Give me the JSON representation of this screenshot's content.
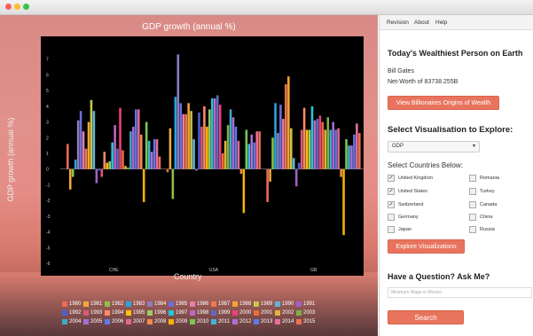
{
  "window": {
    "buttons": [
      "#fc5e57",
      "#fdbc2e",
      "#33c748"
    ]
  },
  "menu": {
    "items": [
      "Revision",
      "About",
      "Help"
    ]
  },
  "chart_data": {
    "type": "bar",
    "title": "GDP growth (annual %)",
    "xlabel": "Country",
    "ylabel": "GDP growth (annual %)",
    "ylim": [
      -6,
      8
    ],
    "yticks": [
      "7",
      "6",
      "5",
      "4",
      "3",
      "2",
      "1",
      "0",
      "-1",
      "-2",
      "-3",
      "-4",
      "-5",
      "-6"
    ],
    "categories": [
      "CHE",
      "USA",
      "GB"
    ],
    "series_colors": [
      "#ee6a56",
      "#f2a93b",
      "#8bc34a",
      "#29a6df",
      "#8e7cc3",
      "#6f6ed9",
      "#e67eac",
      "#f07a4a",
      "#f6a335",
      "#c6c84a",
      "#5fb7d6",
      "#9f61c8",
      "#4c5fd1",
      "#d85b7a",
      "#ff8a65",
      "#ffc107",
      "#9ccc65",
      "#26c6da",
      "#ba68c8",
      "#5c6bc0",
      "#ec407a",
      "#ef6c3a",
      "#e0b43c",
      "#7cb342",
      "#3fa9c9",
      "#a66dd4",
      "#6078ea",
      "#e06a8e",
      "#f28c4a",
      "#f4b400",
      "#78c850",
      "#40b4d8",
      "#b06fd6",
      "#5b7ae6",
      "#e76f9d",
      "#ed7053"
    ],
    "series": [
      {
        "name": "CHE",
        "values": [
          1.6,
          -1.3,
          -0.5,
          0.6,
          3.1,
          3.7,
          2.4,
          1.3,
          3.0,
          4.4,
          3.7,
          -0.9,
          -0.1,
          -0.5,
          1.1,
          0.4,
          0.5,
          1.7,
          2.8,
          1.3,
          3.9,
          1.2,
          0.2,
          0.1,
          2.4,
          2.7,
          3.8,
          3.8,
          2.2,
          -2.1,
          3.0,
          1.8,
          1.1,
          1.9,
          1.9,
          0.8
        ]
      },
      {
        "name": "USA",
        "values": [
          -0.2,
          2.6,
          -1.9,
          4.6,
          7.3,
          4.2,
          3.5,
          3.5,
          4.2,
          3.7,
          1.9,
          -0.1,
          3.6,
          2.7,
          4.0,
          2.7,
          3.8,
          4.5,
          4.5,
          4.7,
          4.1,
          1.0,
          1.8,
          2.8,
          3.8,
          3.3,
          2.7,
          1.8,
          -0.3,
          -2.8,
          2.5,
          1.6,
          2.2,
          1.7,
          2.4,
          2.4
        ]
      },
      {
        "name": "GB",
        "values": [
          -2.1,
          -0.8,
          2.0,
          4.2,
          2.3,
          4.1,
          3.2,
          5.4,
          5.9,
          2.6,
          0.7,
          -1.1,
          0.4,
          2.5,
          3.9,
          2.5,
          2.5,
          4.0,
          3.1,
          3.2,
          3.4,
          3.0,
          2.5,
          3.3,
          2.5,
          3.0,
          2.5,
          2.6,
          -0.5,
          -4.2,
          1.9,
          1.5,
          1.5,
          2.2,
          2.9,
          2.3
        ]
      }
    ],
    "legend": [
      "1980",
      "1981",
      "1982",
      "1983",
      "1984",
      "1985",
      "1986",
      "1987",
      "1988",
      "1989",
      "1990",
      "1991",
      "1992",
      "1993",
      "1994",
      "1995",
      "1996",
      "1997",
      "1998",
      "1999",
      "2000",
      "2001",
      "2002",
      "2003",
      "2004",
      "2005",
      "2006",
      "2007",
      "2008",
      "2009",
      "2010",
      "2011",
      "2012",
      "2013",
      "2014",
      "2015"
    ]
  },
  "panel": {
    "richest_title": "Today's Wealthiest Person on Earth",
    "person_name": "Bill Gates",
    "net_worth": "Net-Worth of 83738.255B",
    "origins_button": "View Billionaires Origins of Wealth",
    "explore_title": "Select Visualisation to Explore:",
    "select_value": "GDP",
    "countries_title": "Select Countries Below:",
    "countries": [
      {
        "label": "United Kingdom",
        "checked": true
      },
      {
        "label": "Romania",
        "checked": false
      },
      {
        "label": "United States",
        "checked": true
      },
      {
        "label": "Turkey",
        "checked": false
      },
      {
        "label": "Switzerland",
        "checked": true
      },
      {
        "label": "Canada",
        "checked": false
      },
      {
        "label": "Germany",
        "checked": false
      },
      {
        "label": "China",
        "checked": false
      },
      {
        "label": "Japan",
        "checked": false
      },
      {
        "label": "Russia",
        "checked": false
      }
    ],
    "explore_button": "Explore Visualizations",
    "question_title": "Have a Question? Ask Me?",
    "question_placeholder": "Minimum Wage in Mexico",
    "search_button": "Search"
  }
}
